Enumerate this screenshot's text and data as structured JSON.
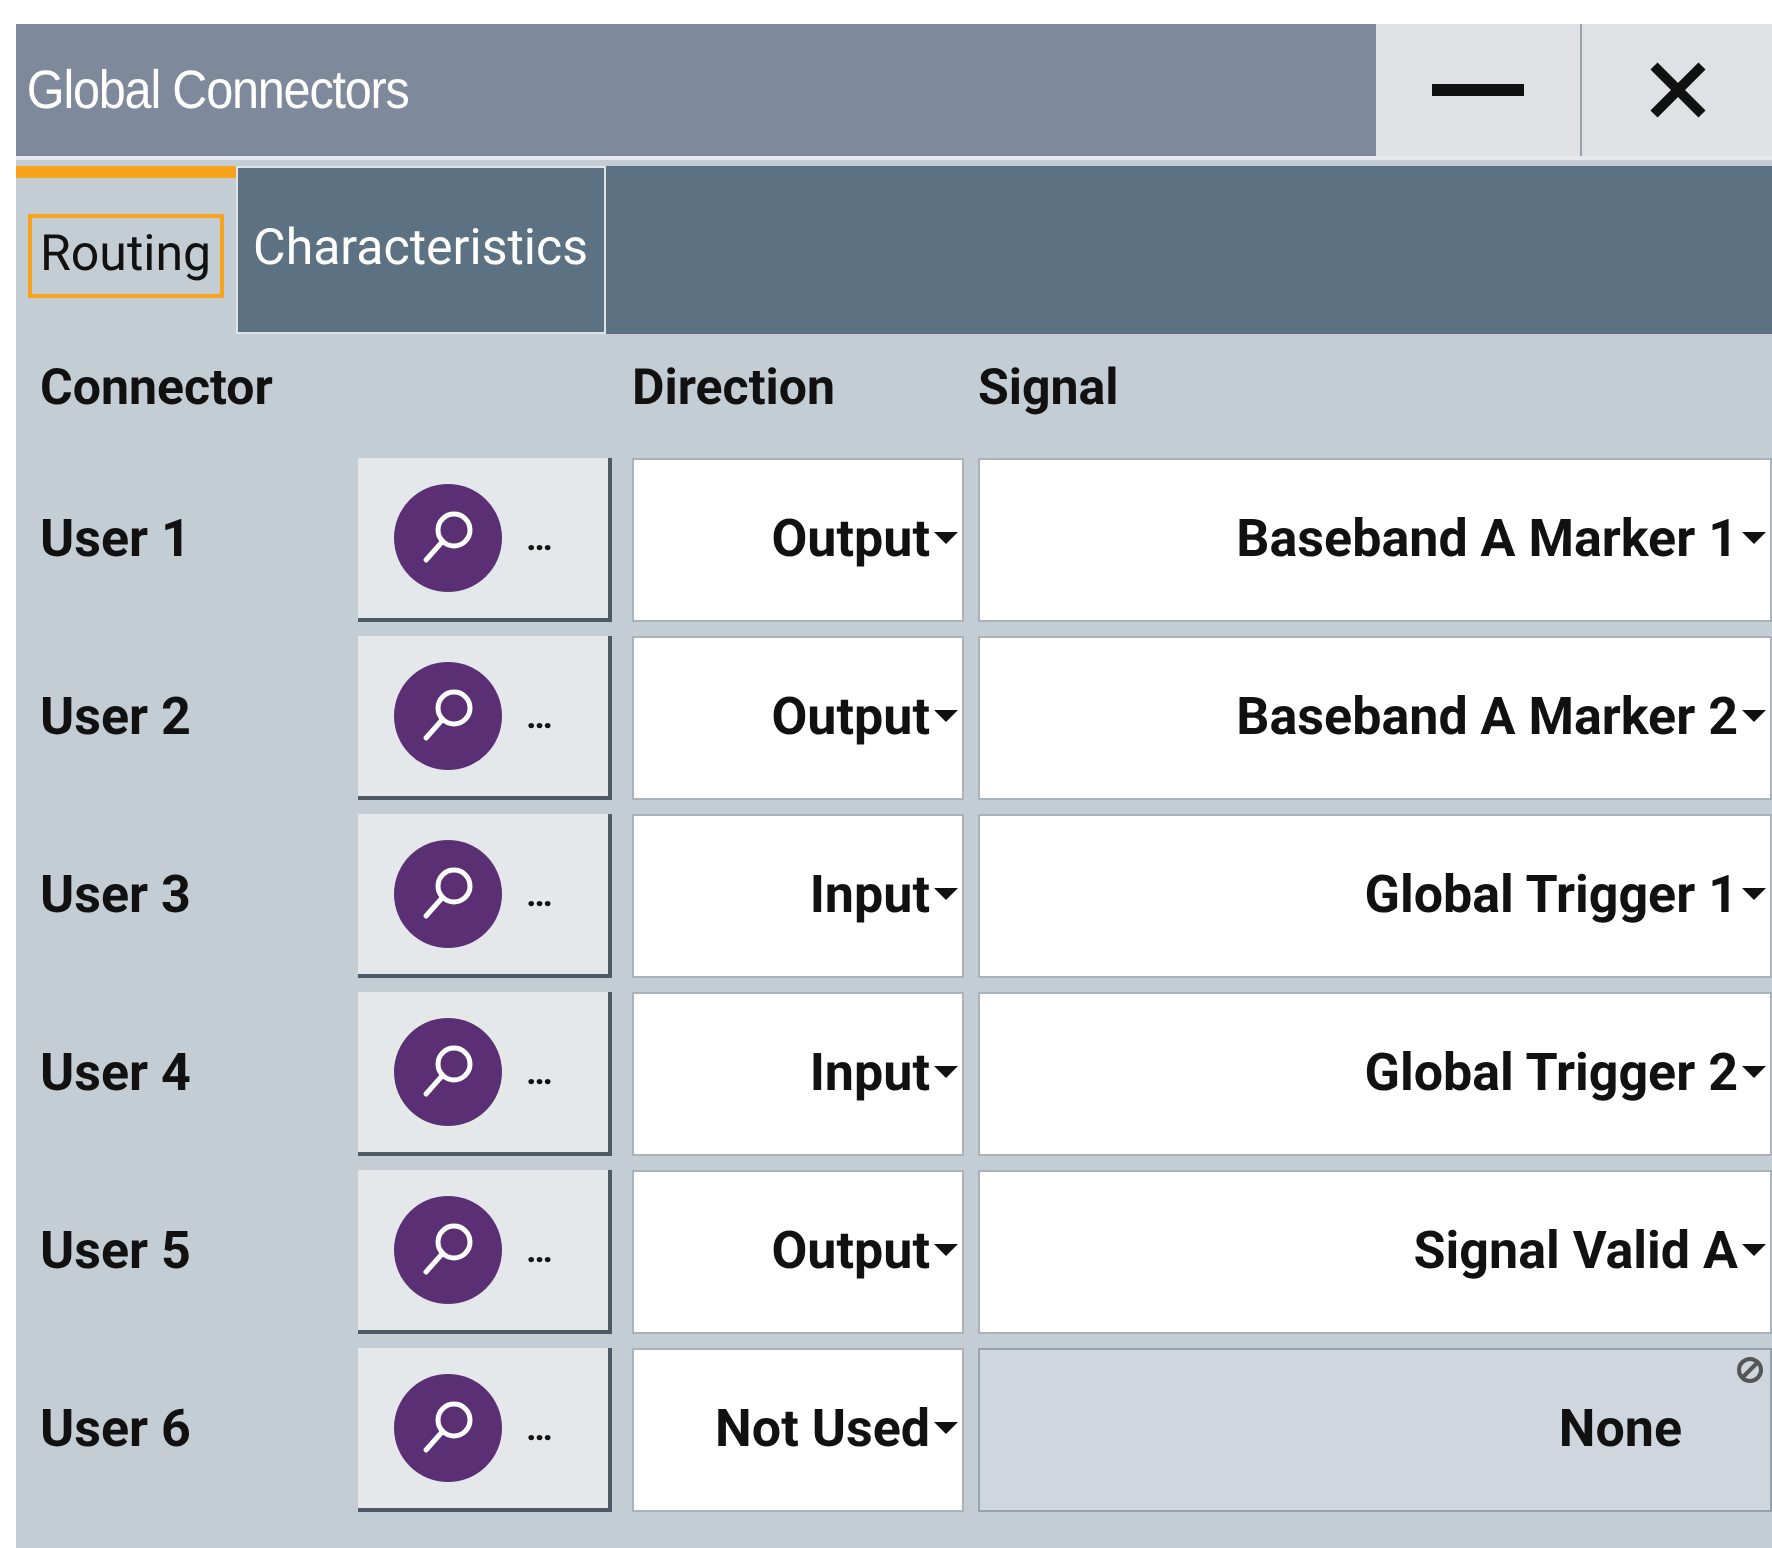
{
  "window": {
    "title": "Global Connectors"
  },
  "tabs": [
    {
      "label": "Routing",
      "selected": true
    },
    {
      "label": "Characteristics",
      "selected": false
    }
  ],
  "columns": [
    "Connector",
    "Direction",
    "Signal"
  ],
  "rows": [
    {
      "connector": "User 1",
      "button": "…",
      "direction": "Output",
      "signal": "Baseband A Marker 1",
      "signal_disabled": false
    },
    {
      "connector": "User 2",
      "button": "…",
      "direction": "Output",
      "signal": "Baseband A Marker 2",
      "signal_disabled": false
    },
    {
      "connector": "User 3",
      "button": "…",
      "direction": "Input",
      "signal": "Global Trigger 1",
      "signal_disabled": false
    },
    {
      "connector": "User 4",
      "button": "…",
      "direction": "Input",
      "signal": "Global Trigger 2",
      "signal_disabled": false
    },
    {
      "connector": "User 5",
      "button": "…",
      "direction": "Output",
      "signal": "Signal Valid A",
      "signal_disabled": false
    },
    {
      "connector": "User 6",
      "button": "…",
      "direction": "Not Used",
      "signal": "None",
      "signal_disabled": true
    }
  ]
}
